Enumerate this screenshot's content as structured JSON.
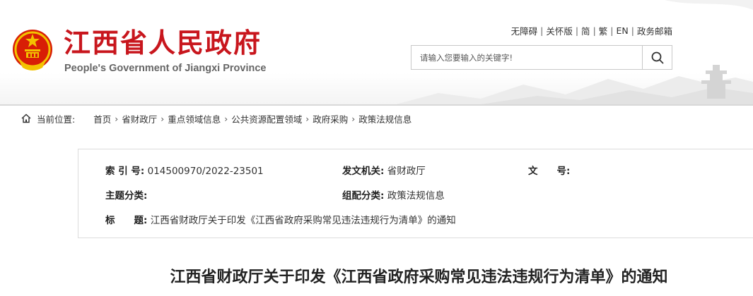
{
  "header": {
    "title": "江西省人民政府",
    "subtitle": "People's Government of Jiangxi Province",
    "top_links": [
      "无障碍",
      "关怀版",
      "简",
      "繁",
      "EN",
      "政务邮箱"
    ],
    "search": {
      "placeholder": "请输入您要输入的关键字!"
    }
  },
  "breadcrumb": {
    "label": "当前位置:",
    "items": [
      "首页",
      "省财政厅",
      "重点领域信息",
      "公共资源配置领域",
      "政府采购",
      "政策法规信息"
    ]
  },
  "info": {
    "index_label": "索 引 号:",
    "index_value": "014500970/2022-23501",
    "issuer_label": "发文机关:",
    "issuer_value": "省财政厅",
    "docno_label": "文　　号:",
    "docno_value": "",
    "topic_label": "主题分类:",
    "topic_value": "",
    "category_label": "组配分类:",
    "category_value": "政策法规信息",
    "title_label": "标　　题:",
    "title_value": "江西省财政厅关于印发《江西省政府采购常见违法违规行为清单》的通知"
  },
  "article": {
    "title": "江西省财政厅关于印发《江西省政府采购常见违法违规行为清单》的通知"
  },
  "colors": {
    "brand_red": "#c8161d",
    "emblem_gold": "#f3c300"
  }
}
